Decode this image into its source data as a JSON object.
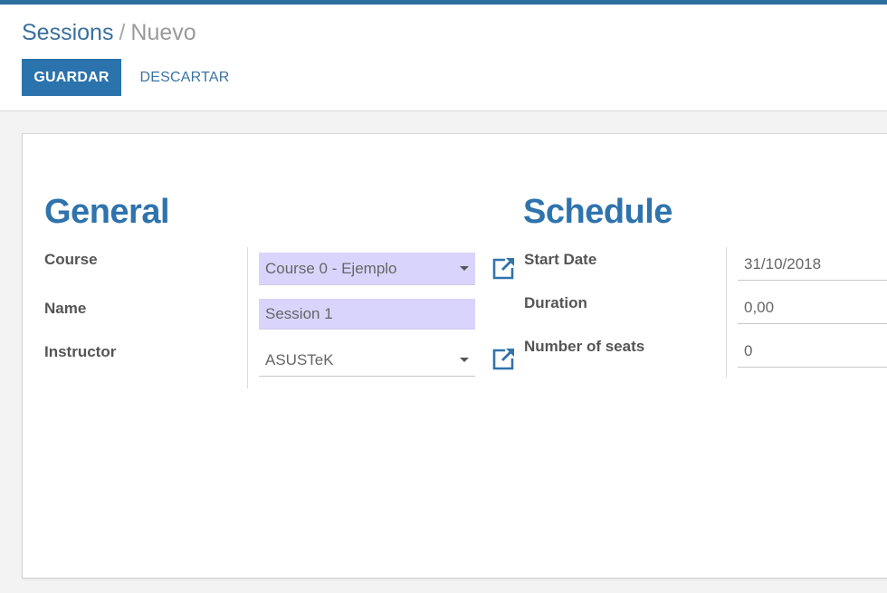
{
  "breadcrumb": {
    "parent": "Sessions",
    "separator": "/",
    "current": "Nuevo"
  },
  "toolbar": {
    "save_label": "GUARDAR",
    "discard_label": "DESCARTAR"
  },
  "general": {
    "title": "General",
    "course": {
      "label": "Course",
      "value": "Course 0 - Ejemplo"
    },
    "name": {
      "label": "Name",
      "value": "Session 1"
    },
    "instructor": {
      "label": "Instructor",
      "value": "ASUSTeK"
    }
  },
  "schedule": {
    "title": "Schedule",
    "start_date": {
      "label": "Start Date",
      "value": "31/10/2018"
    },
    "duration": {
      "label": "Duration",
      "value": "0,00"
    },
    "seats": {
      "label": "Number of seats",
      "value": "0"
    }
  },
  "colors": {
    "accent": "#2a73ad",
    "required_field": "#d9d4fb",
    "title": "#2f73ad"
  }
}
